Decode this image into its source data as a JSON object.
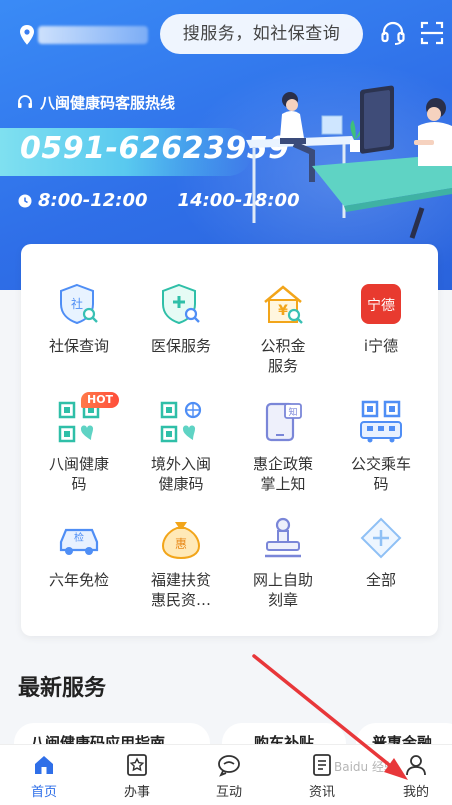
{
  "search": {
    "placeholder": "搜服务，如社保查询"
  },
  "banner": {
    "hotline_title": "八闽健康码客服热线",
    "phone": "0591-62623959",
    "hours_morning": "8:00-12:00",
    "hours_afternoon": "14:00-18:00"
  },
  "services": [
    {
      "label": "社保查询",
      "icon": "social-security-shield-icon"
    },
    {
      "label": "医保服务",
      "icon": "medical-insurance-shield-icon"
    },
    {
      "label": "公积金\n服务",
      "icon": "housing-fund-icon"
    },
    {
      "label": "i宁德",
      "icon": "ningde-logo-icon",
      "icon_text": "宁德"
    },
    {
      "label": "八闽健康\n码",
      "icon": "health-code-icon",
      "badge": "HOT"
    },
    {
      "label": "境外入闽\n健康码",
      "icon": "overseas-health-code-icon"
    },
    {
      "label": "惠企政策\n掌上知",
      "icon": "policy-phone-icon",
      "icon_text": "知"
    },
    {
      "label": "公交乘车\n码",
      "icon": "bus-code-icon"
    },
    {
      "label": "六年免检",
      "icon": "car-inspection-icon",
      "icon_text": "检"
    },
    {
      "label": "福建扶贫\n惠民资…",
      "icon": "money-bag-icon",
      "icon_text": "惠"
    },
    {
      "label": "网上自助\n刻章",
      "icon": "stamp-icon"
    },
    {
      "label": "全部",
      "icon": "all-diamond-icon"
    }
  ],
  "section_title": "最新服务",
  "latest_chips": [
    "八闽健康码应用指南",
    "购车补贴",
    "普惠金融"
  ],
  "tabs": [
    {
      "label": "首页",
      "icon": "home-icon",
      "active": true
    },
    {
      "label": "办事",
      "icon": "star-doc-icon",
      "active": false
    },
    {
      "label": "互动",
      "icon": "chat-icon",
      "active": false
    },
    {
      "label": "资讯",
      "icon": "news-icon",
      "active": false
    },
    {
      "label": "我的",
      "icon": "user-icon",
      "active": false
    }
  ],
  "colors": {
    "primary": "#2f6fe8",
    "accent_red": "#e8373a",
    "hot": "#ff5a3c"
  },
  "watermark": "Baidu 经验"
}
